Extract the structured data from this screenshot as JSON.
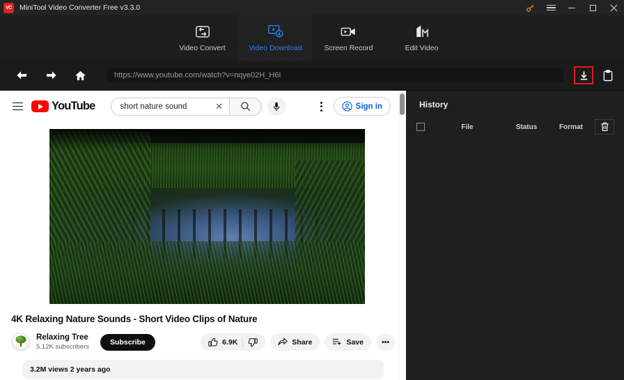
{
  "titlebar": {
    "app_name": "MiniTool Video Converter Free v3.3.0",
    "logo_text": "VC",
    "controls": {
      "key": "register-key",
      "menu": "menu",
      "minimize": "minimize",
      "maximize": "maximize",
      "close": "close"
    }
  },
  "tabs": [
    {
      "label": "Video Convert",
      "icon": "convert-icon",
      "active": false
    },
    {
      "label": "Video Download",
      "icon": "download-video-icon",
      "active": true
    },
    {
      "label": "Screen Record",
      "icon": "camcorder-icon",
      "active": false
    },
    {
      "label": "Edit Video",
      "icon": "edit-video-icon",
      "active": false
    }
  ],
  "urlbar": {
    "back": "back",
    "forward": "forward",
    "home": "home",
    "url": "https://www.youtube.com/watch?v=nqye02H_H6I",
    "download_button": "download",
    "clipboard_button": "paste-clipboard",
    "highlight_color": "#e01b1b"
  },
  "youtube": {
    "brand": "YouTube",
    "search_value": "short nature sound",
    "search_placeholder": "Search",
    "clear_icon": "✕",
    "sign_in": "Sign in",
    "video": {
      "title": "4K Relaxing Nature Sounds - Short Video Clips of Nature",
      "channel": "Relaxing Tree",
      "subscribers": "5.12K subscribers",
      "subscribe": "Subscribe",
      "likes": "6.9K",
      "share": "Share",
      "save": "Save",
      "more": "•••",
      "description": "3.2M views  2 years ago"
    }
  },
  "history": {
    "title": "History",
    "columns": [
      "File",
      "Status",
      "Format"
    ],
    "select_all": "select-all-checkbox",
    "delete": "delete-all",
    "rows": []
  }
}
